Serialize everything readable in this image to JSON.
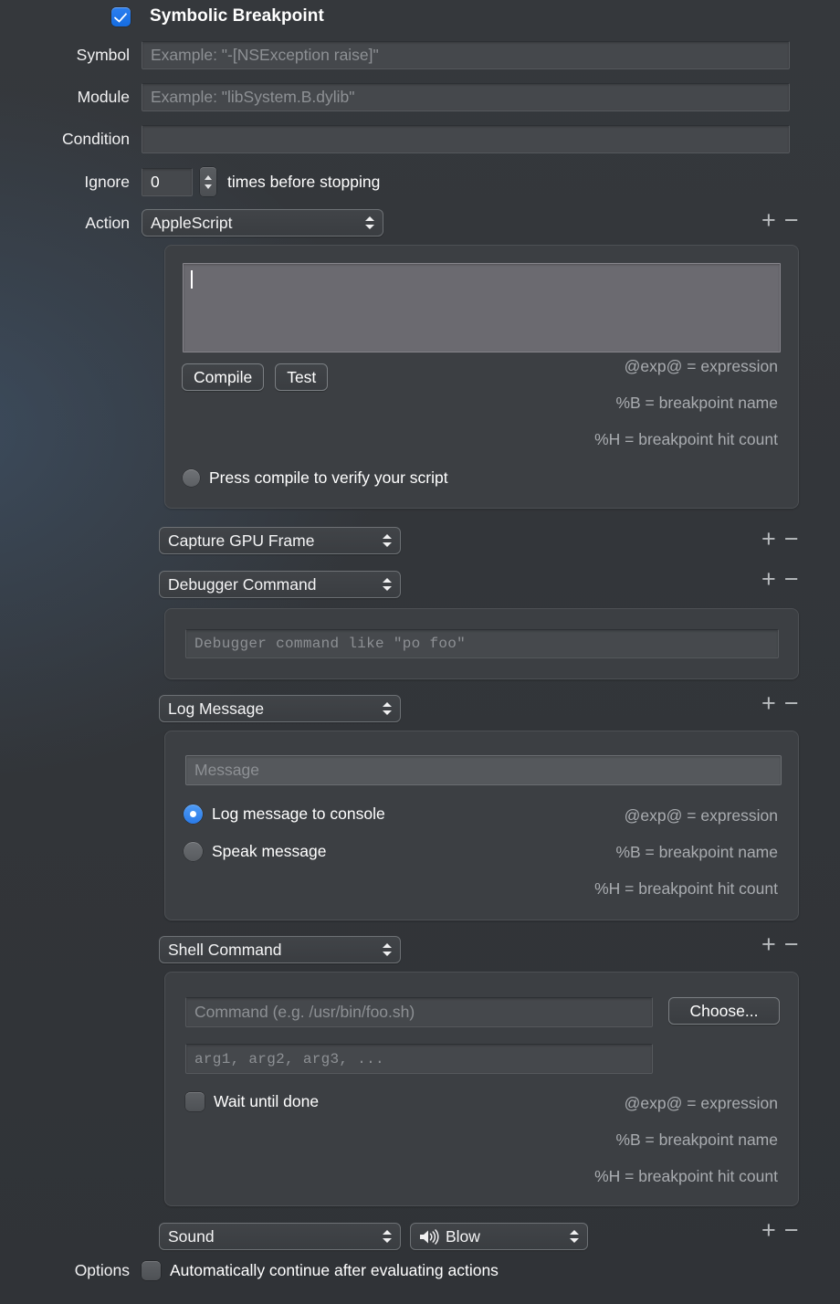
{
  "header": {
    "title": "Symbolic Breakpoint",
    "enabled_checkbox": "checkbox-checked",
    "accent_color": "#1f74e0"
  },
  "fields": {
    "symbol": {
      "label": "Symbol",
      "value": "",
      "placeholder": "Example: \"-[NSException raise]\""
    },
    "module": {
      "label": "Module",
      "value": "",
      "placeholder": "Example: \"libSystem.B.dylib\""
    },
    "condition": {
      "label": "Condition",
      "value": "",
      "placeholder": ""
    },
    "ignore": {
      "label": "Ignore",
      "value": "0",
      "suffix": "times before stopping"
    }
  },
  "actions_label": "Action",
  "options_label": "Options",
  "tokens": [
    "@exp@ = expression",
    "%B = breakpoint name",
    "%H = breakpoint hit count"
  ],
  "add_remove": {
    "add": "+",
    "remove": "−"
  },
  "actions": [
    {
      "type": "applescript",
      "popup_value": "AppleScript",
      "script_value": "",
      "compile_label": "Compile",
      "test_label": "Test",
      "status_text": "Press compile to verify your script",
      "status_indicator": "gray-dot"
    },
    {
      "type": "capture_gpu_frame",
      "popup_value": "Capture GPU Frame"
    },
    {
      "type": "debugger_command",
      "popup_value": "Debugger Command",
      "command_value": "",
      "command_placeholder": "Debugger command like \"po foo\""
    },
    {
      "type": "log_message",
      "popup_value": "Log Message",
      "message_value": "",
      "message_placeholder": "Message",
      "radio_options": [
        {
          "label": "Log message to console",
          "selected": true
        },
        {
          "label": "Speak message",
          "selected": false
        }
      ]
    },
    {
      "type": "shell_command",
      "popup_value": "Shell Command",
      "command_value": "",
      "command_placeholder": "Command (e.g. /usr/bin/foo.sh)",
      "choose_label": "Choose...",
      "args_value": "",
      "args_placeholder": "arg1, arg2, arg3, ...",
      "wait_label": "Wait until done",
      "wait_checked": false
    },
    {
      "type": "sound",
      "popup_value": "Sound",
      "sound_name": "Blow",
      "sound_icon": "speaker-waves-icon"
    }
  ],
  "options": {
    "auto_continue_label": "Automatically continue after evaluating actions",
    "auto_continue_checked": false
  }
}
